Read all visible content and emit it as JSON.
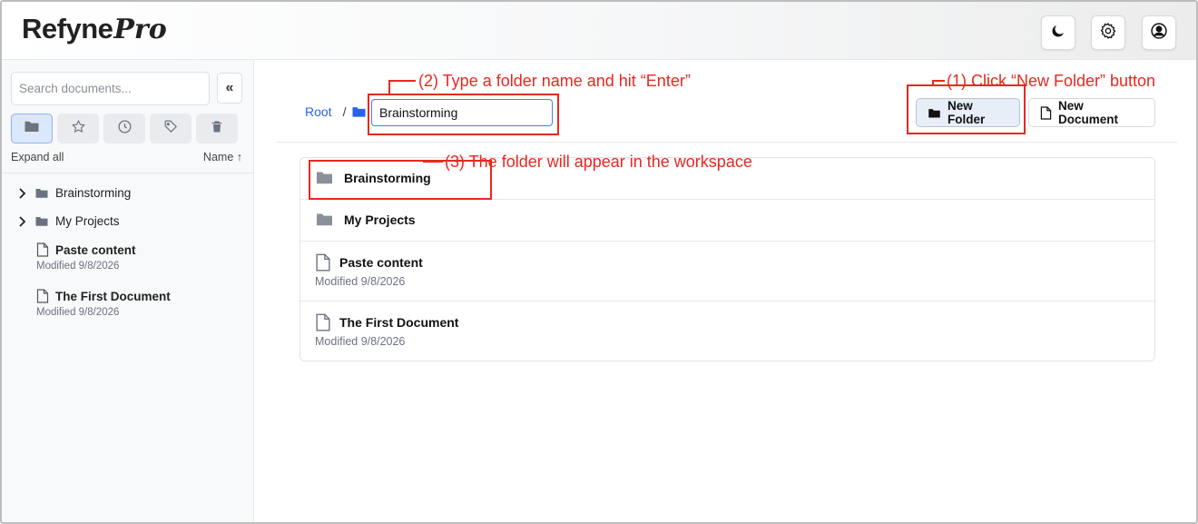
{
  "app": {
    "logo_main": "Refyne",
    "logo_pro": "Pro"
  },
  "header": {
    "icons": [
      "moon-icon",
      "gear-icon",
      "user-icon"
    ]
  },
  "sidebar": {
    "search_placeholder": "Search documents...",
    "collapse_label": "«",
    "tabs": [
      "folder-icon",
      "star-icon",
      "clock-icon",
      "tag-icon",
      "trash-icon"
    ],
    "expand_all": "Expand all",
    "sort_label": "Name ↑",
    "folders": [
      {
        "label": "Brainstorming"
      },
      {
        "label": "My Projects"
      }
    ],
    "documents": [
      {
        "label": "Paste content",
        "modified": "Modified 9/8/2026"
      },
      {
        "label": "The First Document",
        "modified": "Modified 9/8/2026"
      }
    ]
  },
  "main": {
    "breadcrumb_root": "Root",
    "breadcrumb_sep": "/",
    "new_folder_value": "Brainstorming",
    "new_folder_button": "New Folder",
    "new_document_button": "New Document",
    "items": [
      {
        "type": "folder",
        "label": "Brainstorming"
      },
      {
        "type": "folder",
        "label": "My Projects"
      },
      {
        "type": "document",
        "label": "Paste content",
        "modified": "Modified 9/8/2026"
      },
      {
        "type": "document",
        "label": "The First Document",
        "modified": "Modified 9/8/2026"
      }
    ]
  },
  "annotations": {
    "step1": "(1) Click “New Folder” button",
    "step2": "(2) Type a folder name and hit “Enter”",
    "step3": "(3) The folder will appear in the workspace",
    "color": "#e8281f"
  }
}
